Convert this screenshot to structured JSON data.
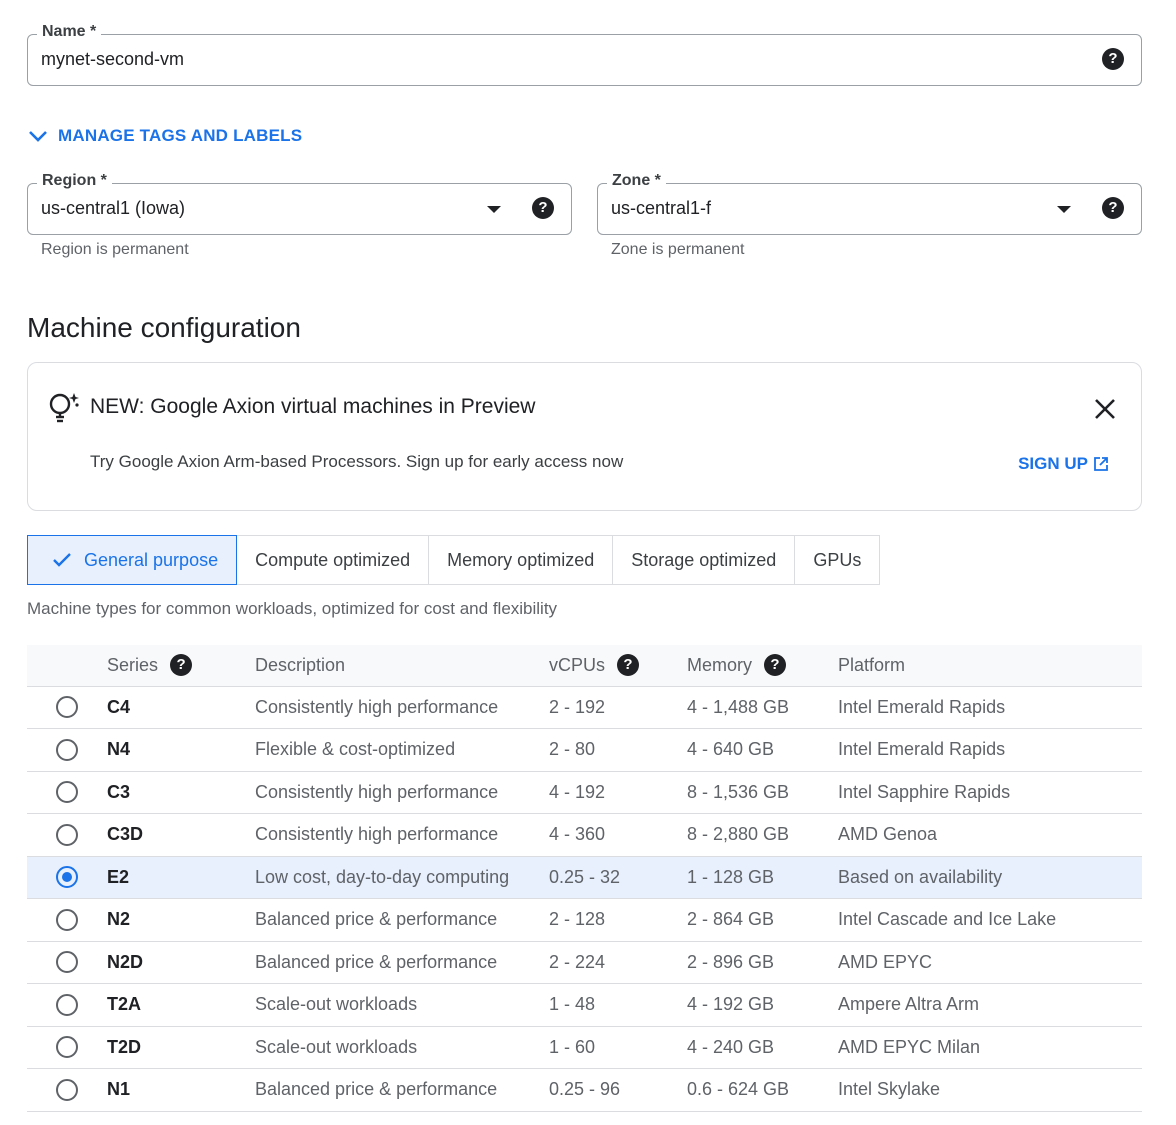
{
  "name_field": {
    "label": "Name *",
    "value": "mynet-second-vm"
  },
  "manage_tags": {
    "label": "MANAGE TAGS AND LABELS"
  },
  "region_field": {
    "label": "Region *",
    "value": "us-central1 (Iowa)",
    "hint": "Region is permanent"
  },
  "zone_field": {
    "label": "Zone *",
    "value": "us-central1-f",
    "hint": "Zone is permanent"
  },
  "section": {
    "title": "Machine configuration"
  },
  "banner": {
    "title": "NEW: Google Axion virtual machines in Preview",
    "text": "Try Google Axion Arm-based Processors. Sign up for early access now",
    "signup": "SIGN UP"
  },
  "tabs": [
    {
      "label": "General purpose",
      "active": true
    },
    {
      "label": "Compute optimized"
    },
    {
      "label": "Memory optimized"
    },
    {
      "label": "Storage optimized"
    },
    {
      "label": "GPUs"
    }
  ],
  "tabs_description": "Machine types for common workloads, optimized for cost and flexibility",
  "table": {
    "headers": {
      "series": "Series",
      "description": "Description",
      "vcpus": "vCPUs",
      "memory": "Memory",
      "platform": "Platform"
    },
    "rows": [
      {
        "series": "C4",
        "description": "Consistently high performance",
        "vcpus": "2 - 192",
        "memory": "4 - 1,488 GB",
        "platform": "Intel Emerald Rapids"
      },
      {
        "series": "N4",
        "description": "Flexible & cost-optimized",
        "vcpus": "2 - 80",
        "memory": "4 - 640 GB",
        "platform": "Intel Emerald Rapids"
      },
      {
        "series": "C3",
        "description": "Consistently high performance",
        "vcpus": "4 - 192",
        "memory": "8 - 1,536 GB",
        "platform": "Intel Sapphire Rapids"
      },
      {
        "series": "C3D",
        "description": "Consistently high performance",
        "vcpus": "4 - 360",
        "memory": "8 - 2,880 GB",
        "platform": "AMD Genoa"
      },
      {
        "series": "E2",
        "description": "Low cost, day-to-day computing",
        "vcpus": "0.25 - 32",
        "memory": "1 - 128 GB",
        "platform": "Based on availability",
        "selected": true
      },
      {
        "series": "N2",
        "description": "Balanced price & performance",
        "vcpus": "2 - 128",
        "memory": "2 - 864 GB",
        "platform": "Intel Cascade and Ice Lake"
      },
      {
        "series": "N2D",
        "description": "Balanced price & performance",
        "vcpus": "2 - 224",
        "memory": "2 - 896 GB",
        "platform": "AMD EPYC"
      },
      {
        "series": "T2A",
        "description": "Scale-out workloads",
        "vcpus": "1 - 48",
        "memory": "4 - 192 GB",
        "platform": "Ampere Altra Arm"
      },
      {
        "series": "T2D",
        "description": "Scale-out workloads",
        "vcpus": "1 - 60",
        "memory": "4 - 240 GB",
        "platform": "AMD EPYC Milan"
      },
      {
        "series": "N1",
        "description": "Balanced price & performance",
        "vcpus": "0.25 - 96",
        "memory": "0.6 - 624 GB",
        "platform": "Intel Skylake"
      }
    ]
  },
  "colors": {
    "accent": "#1a73e8",
    "selected_row": "#e8f0fe",
    "border": "#dadce0"
  }
}
